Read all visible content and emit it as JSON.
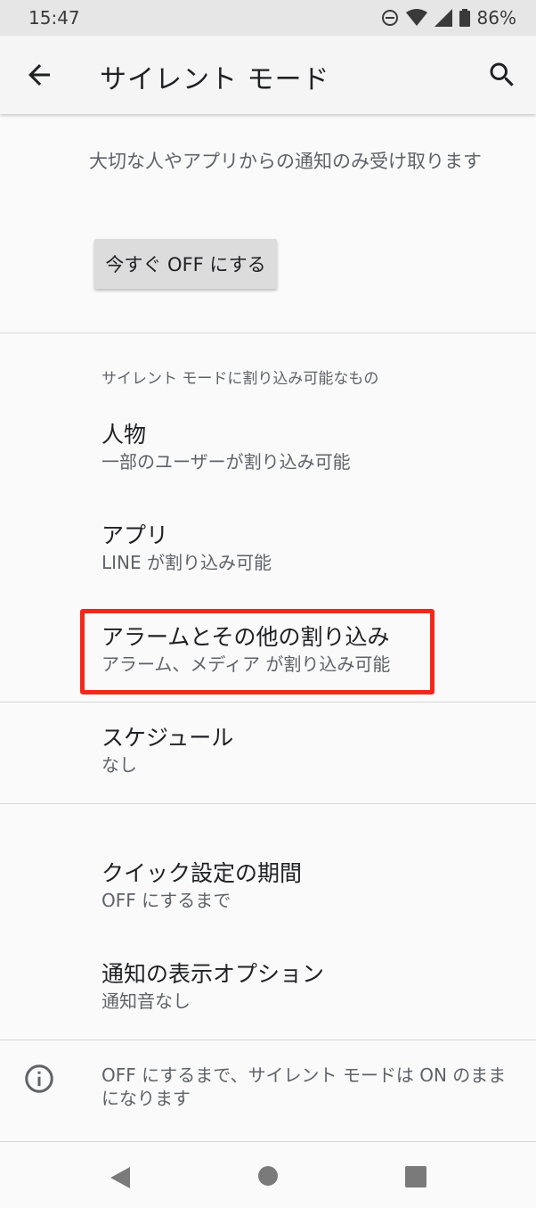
{
  "status_bar": {
    "time": "15:47",
    "battery": "86%",
    "icons": [
      "dnd-icon",
      "wifi-icon",
      "signal-icon",
      "battery-icon"
    ]
  },
  "app_bar": {
    "title": "サイレント モード",
    "back_icon": "arrow-back-icon",
    "search_icon": "search-icon"
  },
  "intro": {
    "description": "大切な人やアプリからの通知のみ受け取ります",
    "button_label": "今すぐ OFF にする"
  },
  "interrupt_section": {
    "header": "サイレント モードに割り込み可能なもの",
    "items": [
      {
        "title": "人物",
        "subtitle": "一部のユーザーが割り込み可能"
      },
      {
        "title": "アプリ",
        "subtitle": "LINE が割り込み可能"
      },
      {
        "title": "アラームとその他の割り込み",
        "subtitle": "アラーム、メディア が割り込み可能"
      }
    ]
  },
  "schedule": {
    "title": "スケジュール",
    "subtitle": "なし"
  },
  "options": [
    {
      "title": "クイック設定の期間",
      "subtitle": "OFF にするまで"
    },
    {
      "title": "通知の表示オプション",
      "subtitle": "通知音なし"
    }
  ],
  "footer_info": {
    "icon": "info-icon",
    "text": "OFF にするまで、サイレント モードは ON のままになります"
  },
  "colors": {
    "highlight": "#f2281a",
    "status_bar_bg": "#e6e6e6",
    "background": "#fafafa"
  }
}
